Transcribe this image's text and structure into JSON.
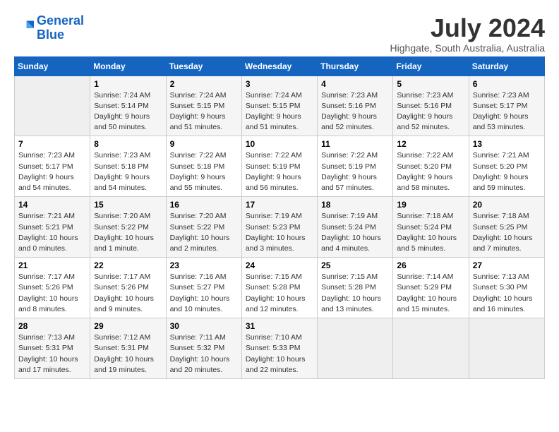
{
  "app": {
    "logo_line1": "General",
    "logo_line2": "Blue"
  },
  "header": {
    "month_year": "July 2024",
    "location": "Highgate, South Australia, Australia"
  },
  "days_of_week": [
    "Sunday",
    "Monday",
    "Tuesday",
    "Wednesday",
    "Thursday",
    "Friday",
    "Saturday"
  ],
  "weeks": [
    [
      {
        "day": "",
        "info": ""
      },
      {
        "day": "1",
        "info": "Sunrise: 7:24 AM\nSunset: 5:14 PM\nDaylight: 9 hours\nand 50 minutes."
      },
      {
        "day": "2",
        "info": "Sunrise: 7:24 AM\nSunset: 5:15 PM\nDaylight: 9 hours\nand 51 minutes."
      },
      {
        "day": "3",
        "info": "Sunrise: 7:24 AM\nSunset: 5:15 PM\nDaylight: 9 hours\nand 51 minutes."
      },
      {
        "day": "4",
        "info": "Sunrise: 7:23 AM\nSunset: 5:16 PM\nDaylight: 9 hours\nand 52 minutes."
      },
      {
        "day": "5",
        "info": "Sunrise: 7:23 AM\nSunset: 5:16 PM\nDaylight: 9 hours\nand 52 minutes."
      },
      {
        "day": "6",
        "info": "Sunrise: 7:23 AM\nSunset: 5:17 PM\nDaylight: 9 hours\nand 53 minutes."
      }
    ],
    [
      {
        "day": "7",
        "info": "Sunrise: 7:23 AM\nSunset: 5:17 PM\nDaylight: 9 hours\nand 54 minutes."
      },
      {
        "day": "8",
        "info": "Sunrise: 7:23 AM\nSunset: 5:18 PM\nDaylight: 9 hours\nand 54 minutes."
      },
      {
        "day": "9",
        "info": "Sunrise: 7:22 AM\nSunset: 5:18 PM\nDaylight: 9 hours\nand 55 minutes."
      },
      {
        "day": "10",
        "info": "Sunrise: 7:22 AM\nSunset: 5:19 PM\nDaylight: 9 hours\nand 56 minutes."
      },
      {
        "day": "11",
        "info": "Sunrise: 7:22 AM\nSunset: 5:19 PM\nDaylight: 9 hours\nand 57 minutes."
      },
      {
        "day": "12",
        "info": "Sunrise: 7:22 AM\nSunset: 5:20 PM\nDaylight: 9 hours\nand 58 minutes."
      },
      {
        "day": "13",
        "info": "Sunrise: 7:21 AM\nSunset: 5:20 PM\nDaylight: 9 hours\nand 59 minutes."
      }
    ],
    [
      {
        "day": "14",
        "info": "Sunrise: 7:21 AM\nSunset: 5:21 PM\nDaylight: 10 hours\nand 0 minutes."
      },
      {
        "day": "15",
        "info": "Sunrise: 7:20 AM\nSunset: 5:22 PM\nDaylight: 10 hours\nand 1 minute."
      },
      {
        "day": "16",
        "info": "Sunrise: 7:20 AM\nSunset: 5:22 PM\nDaylight: 10 hours\nand 2 minutes."
      },
      {
        "day": "17",
        "info": "Sunrise: 7:19 AM\nSunset: 5:23 PM\nDaylight: 10 hours\nand 3 minutes."
      },
      {
        "day": "18",
        "info": "Sunrise: 7:19 AM\nSunset: 5:24 PM\nDaylight: 10 hours\nand 4 minutes."
      },
      {
        "day": "19",
        "info": "Sunrise: 7:18 AM\nSunset: 5:24 PM\nDaylight: 10 hours\nand 5 minutes."
      },
      {
        "day": "20",
        "info": "Sunrise: 7:18 AM\nSunset: 5:25 PM\nDaylight: 10 hours\nand 7 minutes."
      }
    ],
    [
      {
        "day": "21",
        "info": "Sunrise: 7:17 AM\nSunset: 5:26 PM\nDaylight: 10 hours\nand 8 minutes."
      },
      {
        "day": "22",
        "info": "Sunrise: 7:17 AM\nSunset: 5:26 PM\nDaylight: 10 hours\nand 9 minutes."
      },
      {
        "day": "23",
        "info": "Sunrise: 7:16 AM\nSunset: 5:27 PM\nDaylight: 10 hours\nand 10 minutes."
      },
      {
        "day": "24",
        "info": "Sunrise: 7:15 AM\nSunset: 5:28 PM\nDaylight: 10 hours\nand 12 minutes."
      },
      {
        "day": "25",
        "info": "Sunrise: 7:15 AM\nSunset: 5:28 PM\nDaylight: 10 hours\nand 13 minutes."
      },
      {
        "day": "26",
        "info": "Sunrise: 7:14 AM\nSunset: 5:29 PM\nDaylight: 10 hours\nand 15 minutes."
      },
      {
        "day": "27",
        "info": "Sunrise: 7:13 AM\nSunset: 5:30 PM\nDaylight: 10 hours\nand 16 minutes."
      }
    ],
    [
      {
        "day": "28",
        "info": "Sunrise: 7:13 AM\nSunset: 5:31 PM\nDaylight: 10 hours\nand 17 minutes."
      },
      {
        "day": "29",
        "info": "Sunrise: 7:12 AM\nSunset: 5:31 PM\nDaylight: 10 hours\nand 19 minutes."
      },
      {
        "day": "30",
        "info": "Sunrise: 7:11 AM\nSunset: 5:32 PM\nDaylight: 10 hours\nand 20 minutes."
      },
      {
        "day": "31",
        "info": "Sunrise: 7:10 AM\nSunset: 5:33 PM\nDaylight: 10 hours\nand 22 minutes."
      },
      {
        "day": "",
        "info": ""
      },
      {
        "day": "",
        "info": ""
      },
      {
        "day": "",
        "info": ""
      }
    ]
  ]
}
